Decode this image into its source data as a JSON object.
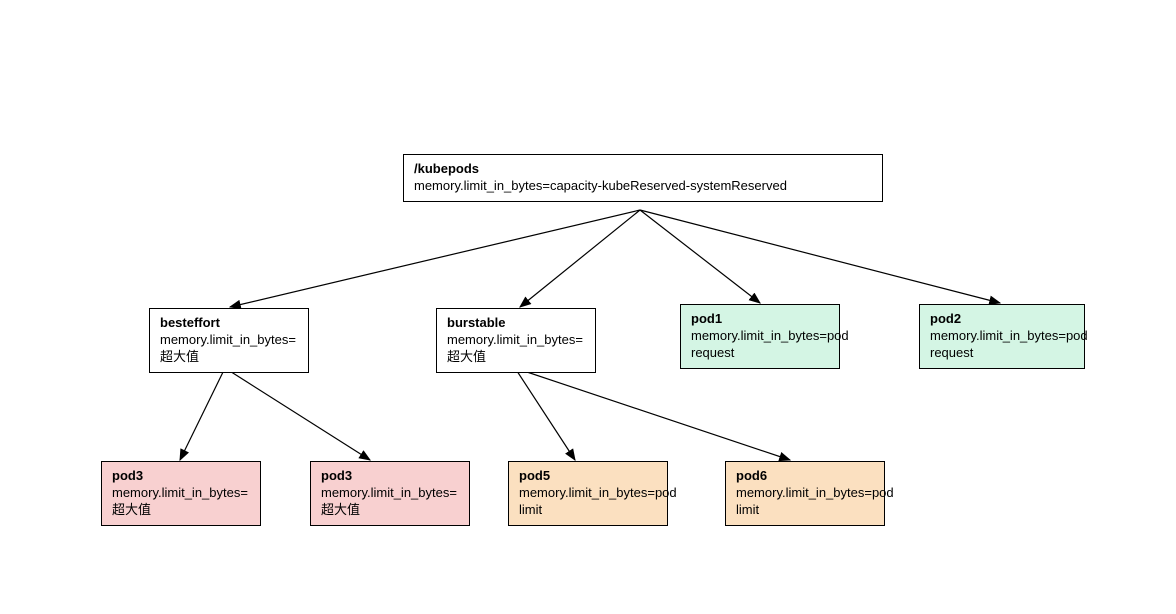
{
  "root": {
    "title": "/kubepods",
    "subtitle": "memory.limit_in_bytes=capacity-kubeReserved-systemReserved"
  },
  "row2": {
    "besteffort": {
      "title": "besteffort",
      "subtitle": "memory.limit_in_bytes=超大值"
    },
    "burstable": {
      "title": "burstable",
      "subtitle": "memory.limit_in_bytes=超大值"
    },
    "pod1": {
      "title": "pod1",
      "subtitle": "memory.limit_in_bytes=pod request"
    },
    "pod2": {
      "title": "pod2",
      "subtitle": "memory.limit_in_bytes=pod request"
    }
  },
  "row3": {
    "pod3a": {
      "title": "pod3",
      "subtitle": "memory.limit_in_bytes=超大值"
    },
    "pod3b": {
      "title": "pod3",
      "subtitle": "memory.limit_in_bytes=超大值"
    },
    "pod5": {
      "title": "pod5",
      "subtitle": "memory.limit_in_bytes=pod limit"
    },
    "pod6": {
      "title": "pod6",
      "subtitle": "memory.limit_in_bytes=pod limit"
    }
  }
}
